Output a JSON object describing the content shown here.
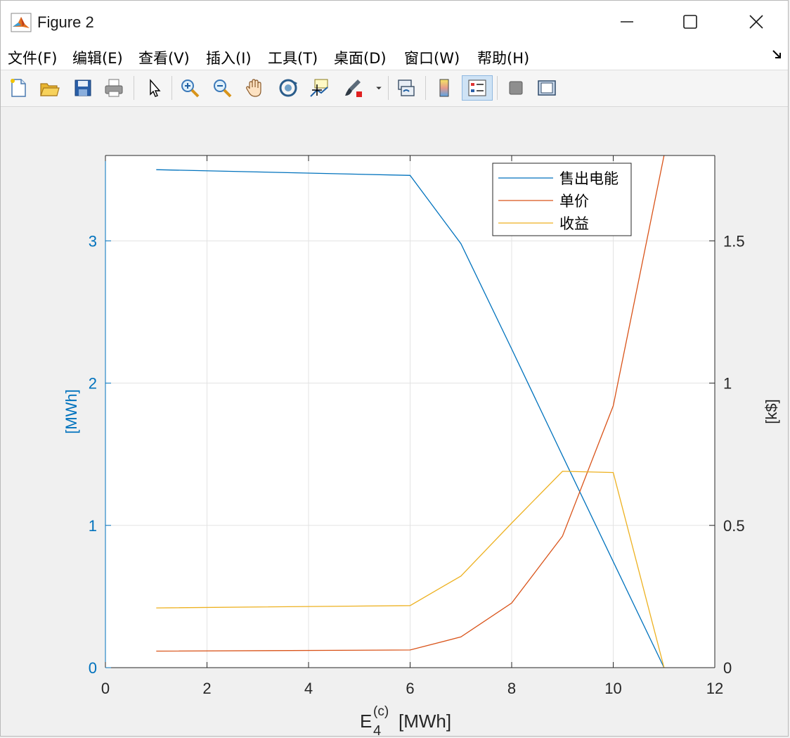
{
  "window": {
    "title": "Figure 2",
    "icon": "matlab-logo-icon"
  },
  "menu": {
    "items": [
      "文件(F)",
      "编辑(E)",
      "查看(V)",
      "插入(I)",
      "工具(T)",
      "桌面(D)",
      "窗口(W)",
      "帮助(H)"
    ]
  },
  "toolbar": {
    "buttons": [
      {
        "name": "new-figure-icon"
      },
      {
        "name": "open-file-icon"
      },
      {
        "name": "save-icon"
      },
      {
        "name": "print-icon"
      },
      {
        "name": "pointer-icon"
      },
      {
        "name": "zoom-in-icon"
      },
      {
        "name": "zoom-out-icon"
      },
      {
        "name": "pan-hand-icon"
      },
      {
        "name": "rotate-3d-icon"
      },
      {
        "name": "data-cursor-icon"
      },
      {
        "name": "brush-icon"
      },
      {
        "name": "link-plot-icon"
      },
      {
        "name": "colorbar-icon"
      },
      {
        "name": "legend-icon"
      },
      {
        "name": "hide-plot-tools-icon"
      },
      {
        "name": "show-plot-tools-icon"
      }
    ]
  },
  "colors": {
    "series1": "#0072bd",
    "series2": "#d95319",
    "series3": "#edb120",
    "left_axis": "#0072bd",
    "right_axis": "#262626"
  },
  "chart_data": {
    "type": "line",
    "xlabel_main": "E",
    "xlabel_sub": "4",
    "xlabel_sup": "(c)",
    "xlabel_unit": "[MWh]",
    "ylabel_left": "[MWh]",
    "ylabel_right": "[k$]",
    "xlim": [
      0,
      12
    ],
    "ylim_left": [
      0,
      3.6
    ],
    "ylim_right": [
      0,
      1.8
    ],
    "xticks": [
      0,
      2,
      4,
      6,
      8,
      10,
      12
    ],
    "yticks_left": [
      0,
      1,
      2,
      3
    ],
    "yticks_right": [
      0,
      0.5,
      1,
      1.5
    ],
    "grid": true,
    "legend_position": "top-right",
    "series": [
      {
        "name": "售出电能",
        "axis": "left",
        "x": [
          1,
          6,
          7,
          8,
          9,
          10,
          11
        ],
        "y": [
          3.5,
          3.46,
          2.98,
          2.24,
          1.49,
          0.745,
          0
        ]
      },
      {
        "name": "单价",
        "axis": "right",
        "x": [
          1,
          6,
          7,
          8,
          9,
          10,
          11
        ],
        "y": [
          0.058,
          0.062,
          0.108,
          0.227,
          0.462,
          0.92,
          1.8
        ]
      },
      {
        "name": "收益",
        "axis": "right",
        "x": [
          1,
          6,
          7,
          8,
          9,
          10,
          11
        ],
        "y": [
          0.21,
          0.218,
          0.322,
          0.508,
          0.69,
          0.686,
          0
        ]
      }
    ]
  }
}
